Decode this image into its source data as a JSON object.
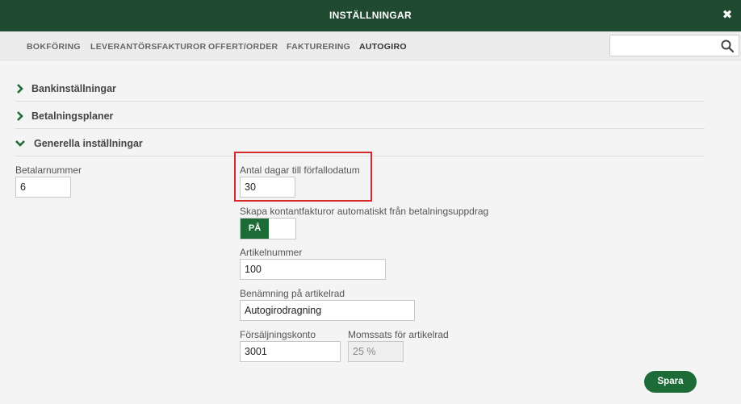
{
  "window": {
    "title": "INSTÄLLNINGAR",
    "close_glyph": "✖"
  },
  "tabs": [
    {
      "label": "BOKFÖRING"
    },
    {
      "label": "LEVERANTÖRSFAKTUROR"
    },
    {
      "label": "OFFERT/ORDER"
    },
    {
      "label": "FAKTURERING"
    },
    {
      "label": "AUTOGIRO",
      "active": true
    }
  ],
  "search": {
    "value": "",
    "placeholder": "",
    "icon": "search-icon"
  },
  "sections": [
    {
      "label": "Bankinställningar",
      "expanded": false
    },
    {
      "label": "Betalningsplaner",
      "expanded": false
    },
    {
      "label": "Generella inställningar",
      "expanded": true
    }
  ],
  "form": {
    "betalarnummer": {
      "label": "Betalarnummer",
      "value": "6"
    },
    "antal_dagar": {
      "label": "Antal dagar till förfallodatum",
      "value": "30"
    },
    "kontantfakturor": {
      "label": "Skapa kontantfakturor automatiskt från betalningsuppdrag",
      "toggle_label": "PÅ",
      "on": true
    },
    "artikelnummer": {
      "label": "Artikelnummer",
      "value": "100"
    },
    "benamning": {
      "label": "Benämning på artikelrad",
      "value": "Autogirodragning"
    },
    "forsaljningskonto": {
      "label": "Försäljningskonto",
      "value": "3001"
    },
    "momssats": {
      "label": "Momssats för artikelrad",
      "value": "25 %"
    }
  },
  "buttons": {
    "save": "Spara"
  },
  "colors": {
    "header": "#1f4a2f",
    "accent": "#1d6b36",
    "highlight": "#d42a2a"
  }
}
